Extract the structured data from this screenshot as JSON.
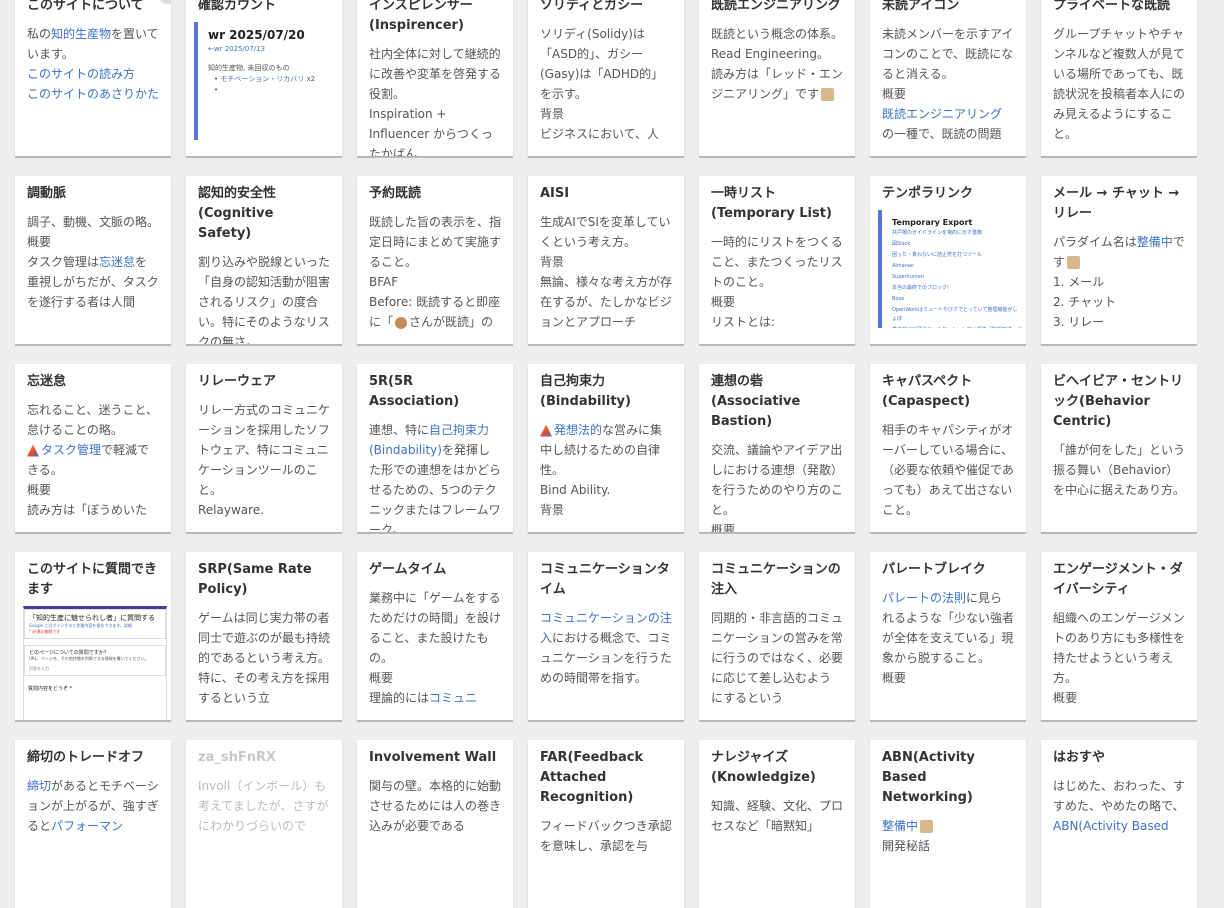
{
  "cards": [
    {
      "title": "このサイトについて",
      "body": [
        [
          "私の",
          {
            "l": "知的生産物"
          },
          "を置いています。"
        ],
        [
          {
            "l": "このサイトの読み方"
          }
        ],
        [
          {
            "l": "このサイトのあさりかた"
          }
        ]
      ]
    },
    {
      "title": "確認カウント",
      "thumb": {
        "title": "wr 2025/07/20",
        "link": "←wr 2025/07/13",
        "line": "知的生産物, 未回収のもの",
        "bullet_link": "モチベーション・リカバリ",
        "bullet_suffix": " x2"
      }
    },
    {
      "title": "インスピレンサー(Inspirencer)",
      "body": [
        [
          "社内全体に対して継続的に改善や変革を啓発する役割。"
        ],
        [
          "Inspiration + Influencer からつくったかばん"
        ]
      ]
    },
    {
      "title": "ソリディとガシー",
      "body": [
        [
          "ソリディ(Solidy)は「ASD的」、ガシー(Gasy)は「ADHD的」を示す。"
        ],
        [
          "背景"
        ],
        [
          "ビジネスにおいて、人"
        ]
      ]
    },
    {
      "title": "既読エンジニアリング",
      "body": [
        [
          "既読という概念の体系。"
        ],
        [
          "Read Engineering。"
        ],
        [
          "読み方は「レッド・エンジニアリング」です",
          {
            "e": 1
          }
        ]
      ]
    },
    {
      "title": "未読アイコン",
      "body": [
        [
          "未読メンバーを示すアイコンのことで、既読になると消える。"
        ],
        [
          "概要"
        ],
        [
          {
            "l": "既読エンジニアリング"
          }
        ],
        [
          "の一種で、既読の問題"
        ]
      ]
    },
    {
      "title": "プライベートな既読",
      "body": [
        [
          "グループチャットやチャンネルなど複数人が見ている場所であっても、既読状況を投稿者本人にのみ見えるようにすること。"
        ]
      ]
    },
    {
      "title": "調動脈",
      "body": [
        [
          "調子、動機、文脈の略。"
        ],
        [
          "概要"
        ],
        [
          "タスク管理は",
          {
            "l": "忘迷怠"
          },
          "を重視しがちだが、タスクを遂行する者は人間"
        ]
      ]
    },
    {
      "title": "認知的安全性(Cognitive Safety)",
      "body": [
        [
          "割り込みや脱線といった「自身の認知活動が阻害されるリスク」の度合い。特にそのようなリスクの無さ。"
        ]
      ]
    },
    {
      "title": "予約既読",
      "body": [
        [
          "既読した旨の表示を、指定日時にまとめて実施すること。"
        ],
        [
          "BFAF"
        ],
        [
          "Before: 既読すると即座に「",
          {
            "d": 1
          },
          "さんが既読」の"
        ]
      ]
    },
    {
      "title": "AISI",
      "body": [
        [
          "生成AIでSIを変革していくという考え方。"
        ],
        [
          "背景"
        ],
        [
          "無論、様々な考え方が存在するが、たしかなビジョンとアプローチ"
        ]
      ]
    },
    {
      "title": "一時リスト(Temporary List)",
      "body": [
        [
          "一時的にリストをつくること、またつくったリストのこと。"
        ],
        [
          "概要"
        ],
        [
          "リストとは:"
        ]
      ]
    },
    {
      "title": "テンポラリンク",
      "thumb2": {
        "title": "Temporary Export",
        "lines": [
          "共戸場のガイドラインを場的に示す書籍",
          "図Slack",
          "困った・真わないに詰止符を打つツール",
          "Almanac",
          "Superhuman",
          "本当の最終でのブロック!",
          "Bose",
          "OpenWorkはミュートやびクでとっていて整理機能がしょぼ",
          "基本的に口頭コミュニケーションでは報告「既報収送」が",
          "無印良品は、仕組みが9割"
        ]
      }
    },
    {
      "title": "メール → チャット → リレー",
      "body": [
        [
          "パラダイム名は",
          {
            "l": "整備中"
          },
          "です",
          {
            "e": 1
          }
        ],
        [
          "1. メール"
        ],
        [
          "2. チャット"
        ],
        [
          "3. リレー"
        ]
      ]
    },
    {
      "title": "忘迷怠",
      "body": [
        [
          "忘れること、迷うこと、怠けることの略。"
        ],
        [
          {
            "t": 1
          },
          {
            "l": "タスク管理"
          },
          "で軽減できる。"
        ],
        [
          "概要"
        ],
        [
          "読み方は「ぼうめいた"
        ]
      ]
    },
    {
      "title": "リレーウェア",
      "body": [
        [
          "リレー方式のコミュニケーションを採用したソフトウェア、特にコミュニケーションツールのこと。"
        ],
        [
          "Relayware."
        ]
      ]
    },
    {
      "title": "5R(5R Association)",
      "body": [
        [
          "連想、特に",
          {
            "l": "自己拘束力(Bindability)"
          },
          "を発揮した形での連想をはかどらせるための、5つのテクニックまたはフレームワーク。"
        ]
      ]
    },
    {
      "title": "自己拘束力(Bindability)",
      "body": [
        [
          {
            "t": 1
          },
          {
            "l": "発想法的"
          },
          "な営みに集中し続けるための自律性。"
        ],
        [
          "Bind Ability."
        ],
        [
          "背景"
        ]
      ]
    },
    {
      "title": "連想の砦(Associative Bastion)",
      "body": [
        [
          "交流、議論やアイデア出しにおける連想（発散）を行うためのやり方のこと。"
        ],
        [
          "概要"
        ]
      ]
    },
    {
      "title": "キャパスペクト(Capaspect)",
      "body": [
        [
          "相手のキャパシティがオーバーしている場合に、（必要な依頼や催促であっても）あえて出さないこと。"
        ]
      ]
    },
    {
      "title": "ビヘイビア・セントリック(Behavior Centric)",
      "body": [
        [
          "「誰が何をした」という振る舞い（Behavior）を中心に据えたあり方。"
        ]
      ]
    },
    {
      "title": "このサイトに質問できます",
      "thumb3": {
        "title": "「知的生産に魅せられし者」に質問する",
        "l1": "Google にログインすると作業内容を保存できます。詳細",
        "l2": "* 必須の質問です",
        "q": "どのページについての質問ですか？",
        "q2": "URL、ページ名、その他特徴を判断できる情報を書いてください。",
        "ans": "回答を入力",
        "foot": "質問内容をどうぞ *"
      }
    },
    {
      "title": "SRP(Same Rate Policy)",
      "body": [
        [
          "ゲームは同じ実力帯の者同士で遊ぶのが最も持続的であるという考え方。特に、その考え方を採用するという立"
        ]
      ]
    },
    {
      "title": "ゲームタイム",
      "body": [
        [
          "業務中に「ゲームをするためだけの時間」を設けること、また設けたもの。"
        ],
        [
          "概要"
        ],
        [
          "理論的には",
          {
            "l": "コミュニ"
          }
        ]
      ]
    },
    {
      "title": "コミュニケーションタイム",
      "body": [
        [
          {
            "l": "コミュニケーションの注入"
          },
          "における概念で、コミュニケーションを行うための時間帯を指す。"
        ]
      ]
    },
    {
      "title": "コミュニケーションの注入",
      "body": [
        [
          "同期的・非言語的コミュニケーションの営みを常に行うのではなく、必要に応じて差し込むようにするという"
        ]
      ]
    },
    {
      "title": "パレートブレイク",
      "body": [
        [
          {
            "l": "パレートの法則"
          },
          "に見られるような「少ない強者が全体を支えている」現象から脱すること。"
        ],
        [
          "概要"
        ]
      ]
    },
    {
      "title": "エンゲージメント・ダイバーシティ",
      "body": [
        [
          "組織へのエンゲージメントのあり方にも多様性を持たせようという考え方。"
        ],
        [
          "概要"
        ]
      ]
    },
    {
      "title": "締切のトレードオフ",
      "body": [
        [
          {
            "l": "締切"
          },
          "があるとモチベーションが上がるが、強すぎると",
          {
            "l": "パフォーマン"
          }
        ]
      ]
    },
    {
      "title": "za_shFnRX",
      "faded": true,
      "body": [
        [
          "Involl（インボール）も考えてましたが、さすがにわかりづらいので"
        ]
      ]
    },
    {
      "title": "Involvement Wall",
      "body": [
        [
          "関与の壁。本格的に始動させるためには人の巻き込みが必要である"
        ]
      ]
    },
    {
      "title": "FAR(Feedback Attached Recognition)",
      "body": [
        [
          "フィードバックつき承認を意味し、承認を与"
        ]
      ]
    },
    {
      "title": "ナレジャイズ(Knowledgize)",
      "body": [
        [
          "知識、経験、文化、プロセスなど「暗黙知」"
        ]
      ]
    },
    {
      "title": "ABN(Activity Based Networking)",
      "body": [
        [
          {
            "l": "整備中"
          },
          {
            "e": 1
          }
        ],
        [
          "開発秘話"
        ]
      ]
    },
    {
      "title": "はおすや",
      "body": [
        [
          "はじめた、おわった、すすめた、やめたの略で、",
          {
            "l": "ABN(Activity Based"
          }
        ]
      ]
    }
  ]
}
